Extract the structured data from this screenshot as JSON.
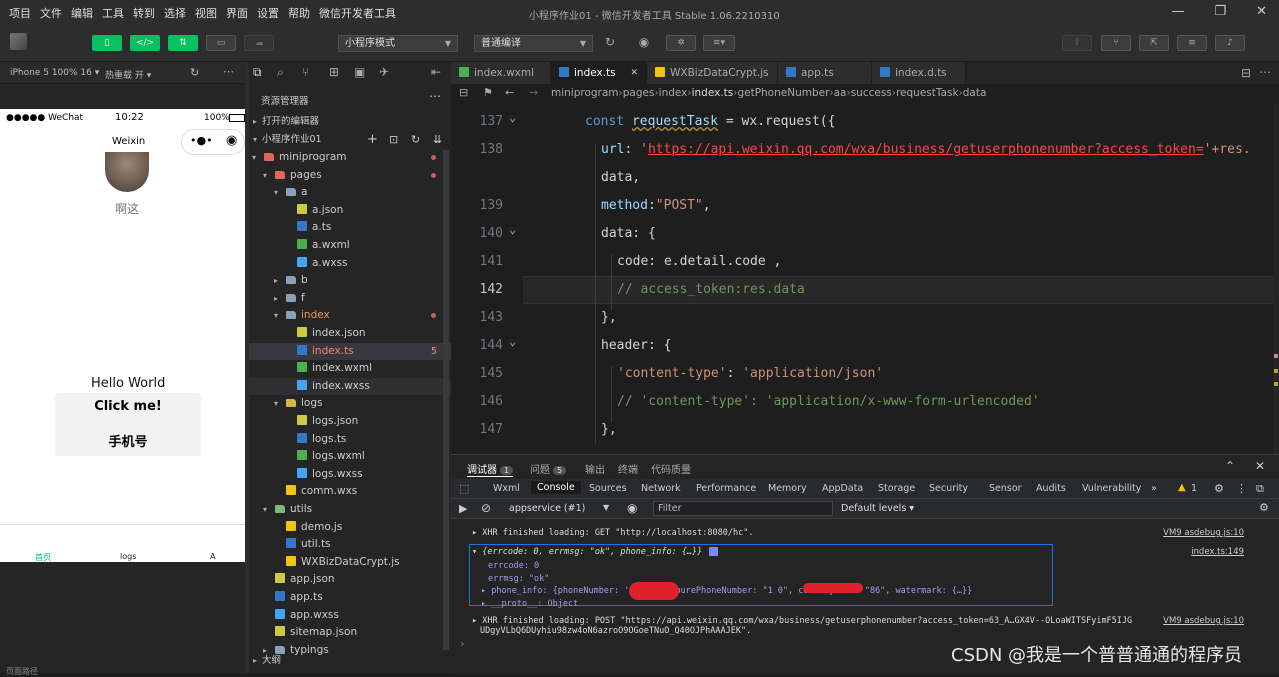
{
  "menu": [
    "项目",
    "文件",
    "编辑",
    "工具",
    "转到",
    "选择",
    "视图",
    "界面",
    "设置",
    "帮助",
    "微信开发者工具"
  ],
  "window_title": "小程序作业01 - 微信开发者工具 Stable 1.06.2210310",
  "window_controls": [
    "—",
    "❐",
    "✕"
  ],
  "toolbar": {
    "mode_select": "小程序模式",
    "compile_select": "普通编译"
  },
  "simulator": {
    "device_label": "iPhone 5 100% 16 ▾",
    "hotreload_label": "热重载 开 ▾",
    "status_carrier": "●●●●● WeChat",
    "status_time": "10:22",
    "status_battery": "100%",
    "nav_title": "Weixin",
    "user_name": "啊这",
    "hello": "Hello World",
    "click_btn": "Click me!",
    "phone_btn": "手机号",
    "tabbar": [
      "首页",
      "logs",
      "A"
    ],
    "bottom_text": "页面路径"
  },
  "explorer": {
    "title": "资源管理器",
    "section_open": "打开的编辑器",
    "project": "小程序作业01",
    "section_outline": "大纲",
    "tree": [
      {
        "label": "miniprogram",
        "type": "folder-red",
        "open": true,
        "depth": 0,
        "dot": true
      },
      {
        "label": "pages",
        "type": "folder-red",
        "open": true,
        "depth": 1,
        "dot": true
      },
      {
        "label": "a",
        "type": "folder",
        "open": true,
        "depth": 2
      },
      {
        "label": "a.json",
        "type": "json",
        "depth": 3
      },
      {
        "label": "a.ts",
        "type": "ts",
        "depth": 3
      },
      {
        "label": "a.wxml",
        "type": "wxml",
        "depth": 3
      },
      {
        "label": "a.wxss",
        "type": "wxss",
        "depth": 3
      },
      {
        "label": "b",
        "type": "folder",
        "open": false,
        "depth": 2
      },
      {
        "label": "f",
        "type": "folder",
        "open": false,
        "depth": 2
      },
      {
        "label": "index",
        "type": "folder",
        "open": true,
        "depth": 2,
        "dot": true,
        "color": "#e89a58"
      },
      {
        "label": "index.json",
        "type": "json",
        "depth": 3
      },
      {
        "label": "index.ts",
        "type": "ts",
        "depth": 3,
        "badge": "5",
        "color": "#f48771",
        "selected": true
      },
      {
        "label": "index.wxml",
        "type": "wxml",
        "depth": 3
      },
      {
        "label": "index.wxss",
        "type": "wxss",
        "depth": 3,
        "hover": true
      },
      {
        "label": "logs",
        "type": "folder-yellow",
        "open": true,
        "depth": 2
      },
      {
        "label": "logs.json",
        "type": "json",
        "depth": 3
      },
      {
        "label": "logs.ts",
        "type": "ts",
        "depth": 3
      },
      {
        "label": "logs.wxml",
        "type": "wxml",
        "depth": 3
      },
      {
        "label": "logs.wxss",
        "type": "wxss",
        "depth": 3
      },
      {
        "label": "comm.wxs",
        "type": "wxs",
        "depth": 2
      },
      {
        "label": "utils",
        "type": "folder-green",
        "open": true,
        "depth": 1
      },
      {
        "label": "demo.js",
        "type": "js",
        "depth": 2
      },
      {
        "label": "util.ts",
        "type": "ts",
        "depth": 2
      },
      {
        "label": "WXBizDataCrypt.js",
        "type": "js",
        "depth": 2
      },
      {
        "label": "app.json",
        "type": "json",
        "depth": 1
      },
      {
        "label": "app.ts",
        "type": "ts",
        "depth": 1
      },
      {
        "label": "app.wxss",
        "type": "wxss",
        "depth": 1
      },
      {
        "label": "sitemap.json",
        "type": "json",
        "depth": 1
      },
      {
        "label": "typings",
        "type": "folder",
        "open": false,
        "depth": 1
      }
    ]
  },
  "editor": {
    "tabs": [
      {
        "label": "index.wxml",
        "type": "wxml"
      },
      {
        "label": "index.ts",
        "type": "ts",
        "active": true
      },
      {
        "label": "WXBizDataCrypt.js",
        "type": "js"
      },
      {
        "label": "app.ts",
        "type": "ts"
      },
      {
        "label": "index.d.ts",
        "type": "ts"
      }
    ],
    "breadcrumb": [
      "miniprogram",
      "pages",
      "index",
      "index.ts",
      "getPhoneNumber",
      "aa",
      "success",
      "requestTask",
      "data"
    ],
    "lines": [
      {
        "n": "137",
        "fold": true
      },
      {
        "n": "138"
      },
      {
        "n": ""
      },
      {
        "n": "139"
      },
      {
        "n": "140",
        "fold": true
      },
      {
        "n": "141"
      },
      {
        "n": "142",
        "current": true
      },
      {
        "n": "143"
      },
      {
        "n": "144",
        "fold": true
      },
      {
        "n": "145"
      },
      {
        "n": "146"
      },
      {
        "n": "147"
      }
    ],
    "code": {
      "l137_kw": "const",
      "l137_var": "requestTask",
      "l137_rest": " = wx.request({",
      "l138_key": "url: ",
      "l138_q": "'",
      "l138_url": "https://api.weixin.qq.com/wxa/business/getuserphonenumber?access_token=",
      "l138_tail": "'+res.",
      "l138b": "data,",
      "l139_key": "method:",
      "l139_val": "\"POST\"",
      "l139_tail": ",",
      "l140": "data: {",
      "l141": "code: e.detail.code ,",
      "l142": "// access_token:res.data",
      "l143": "},",
      "l144": "header: {",
      "l145_key": "'content-type'",
      "l145_sep": ": ",
      "l145_val": "'application/json'",
      "l146": "// 'content-type': 'application/x-www-form-urlencoded'",
      "l147": "},"
    }
  },
  "devtools": {
    "top_tabs": [
      {
        "label": "调试器",
        "badge": "1"
      },
      {
        "label": "问题",
        "badge": "5"
      },
      {
        "label": "输出"
      },
      {
        "label": "终端"
      },
      {
        "label": "代码质量"
      }
    ],
    "tabs": [
      "Wxml",
      "Console",
      "Sources",
      "Network",
      "Performance",
      "Memory",
      "AppData",
      "Storage",
      "Security",
      "Sensor",
      "Audits",
      "Vulnerability",
      "»"
    ],
    "active_tab": "Console",
    "warn_count": "1",
    "context": "appservice (#1)",
    "filter_placeholder": "Filter",
    "levels": "Default levels ▾",
    "console": {
      "l1": "▸ XHR finished loading: GET \"http://localhost:8080/hc\".",
      "l1_src": "VM9 asdebug.js:10",
      "obj_head": "▾ {errcode: 0, errmsg: \"ok\", phone_info: {…}}",
      "obj_src": "index.ts:149",
      "errcode": "errcode: 0",
      "errmsg": "errmsg: \"ok\"",
      "phone": "▸ phone_info: {phoneNumber: '1         5390\", purePhoneNumber: \"1          0\", countryCode: \"86\", watermark: {…}}",
      "proto": "▸ __proto__: Object",
      "l2": "▸ XHR finished loading: POST \"https://api.weixin.qq.com/wxa/business/getuserphonenumber?access_token=63_A…GX4V--OLoaWITSFyimF5IJG",
      "l2b": "UDgyVLbQ6DUyhiu98zw4oN6azroO9OGoeTNuO_Q40OJPhAAAJEK\".",
      "l2_src": "VM9 asdebug.js:10",
      "prompt": "›"
    }
  },
  "watermark": "CSDN @我是一个普普通通的程序员",
  "colors": {
    "accent_green": "#07c160",
    "bg": "#1e1e1e",
    "selection": "#37373d"
  }
}
